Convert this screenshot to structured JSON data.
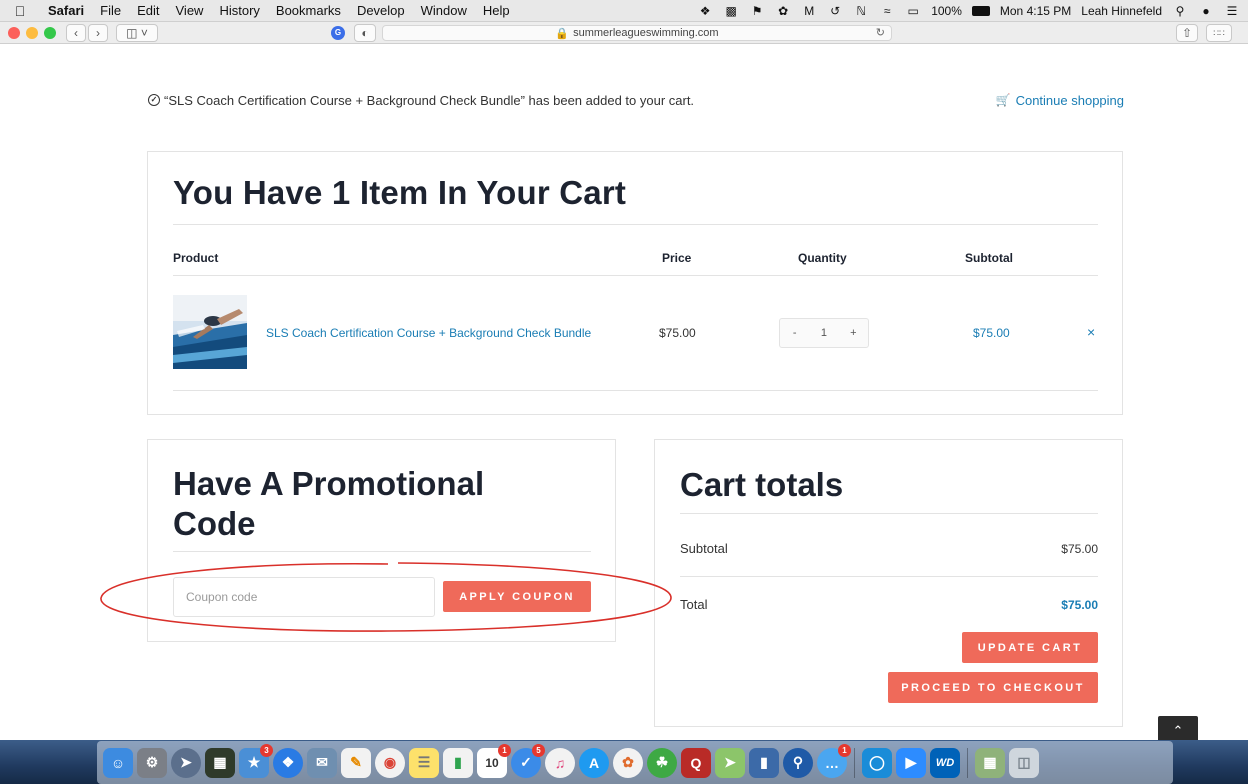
{
  "menubar": {
    "app_name": "Safari",
    "menus": [
      "File",
      "Edit",
      "View",
      "History",
      "Bookmarks",
      "Develop",
      "Window",
      "Help"
    ],
    "battery": "100%",
    "clock": "Mon 4:15 PM",
    "user": "Leah Hinnefeld"
  },
  "browser": {
    "url": "summerleagueswimming.com"
  },
  "notice": {
    "message": "“SLS Coach Certification Course + Background Check Bundle” has been added to your cart.",
    "continue_label": "Continue shopping"
  },
  "cart": {
    "title": "You Have 1 Item In Your Cart",
    "headers": {
      "product": "Product",
      "price": "Price",
      "quantity": "Quantity",
      "subtotal": "Subtotal"
    },
    "item": {
      "name": "SLS Coach Certification Course + Background Check Bundle",
      "price": "$75.00",
      "qty_minus": "-",
      "qty_value": "1",
      "qty_plus": "+",
      "subtotal": "$75.00",
      "remove": "×"
    }
  },
  "promo": {
    "title": "Have A Promotional Code",
    "placeholder": "Coupon code",
    "apply_label": "APPLY COUPON"
  },
  "totals": {
    "title": "Cart totals",
    "subtotal_label": "Subtotal",
    "subtotal_value": "$75.00",
    "total_label": "Total",
    "total_value": "$75.00",
    "update_label": "UPDATE CART",
    "checkout_label": "PROCEED TO CHECKOUT"
  },
  "scroll_top": "⌃",
  "colors": {
    "accent": "#ef6a5a",
    "link": "#1a7db4",
    "annotation": "#d9302a"
  },
  "dock": {
    "badges": {
      "tinder": "3",
      "calendar": "1",
      "things": "5",
      "messages": "1"
    },
    "calendar_day": "10",
    "apps": [
      "finder",
      "system-preferences",
      "launchpad",
      "mission-control",
      "preview",
      "safari",
      "mail",
      "pages",
      "chrome",
      "notes",
      "numbers",
      "calendar",
      "things",
      "itunes",
      "app-store",
      "photos",
      "evernote",
      "quora",
      "maps",
      "keynote",
      "keychain",
      "messages",
      "1password",
      "zoom",
      "wd",
      "photo-library",
      "trash"
    ]
  }
}
